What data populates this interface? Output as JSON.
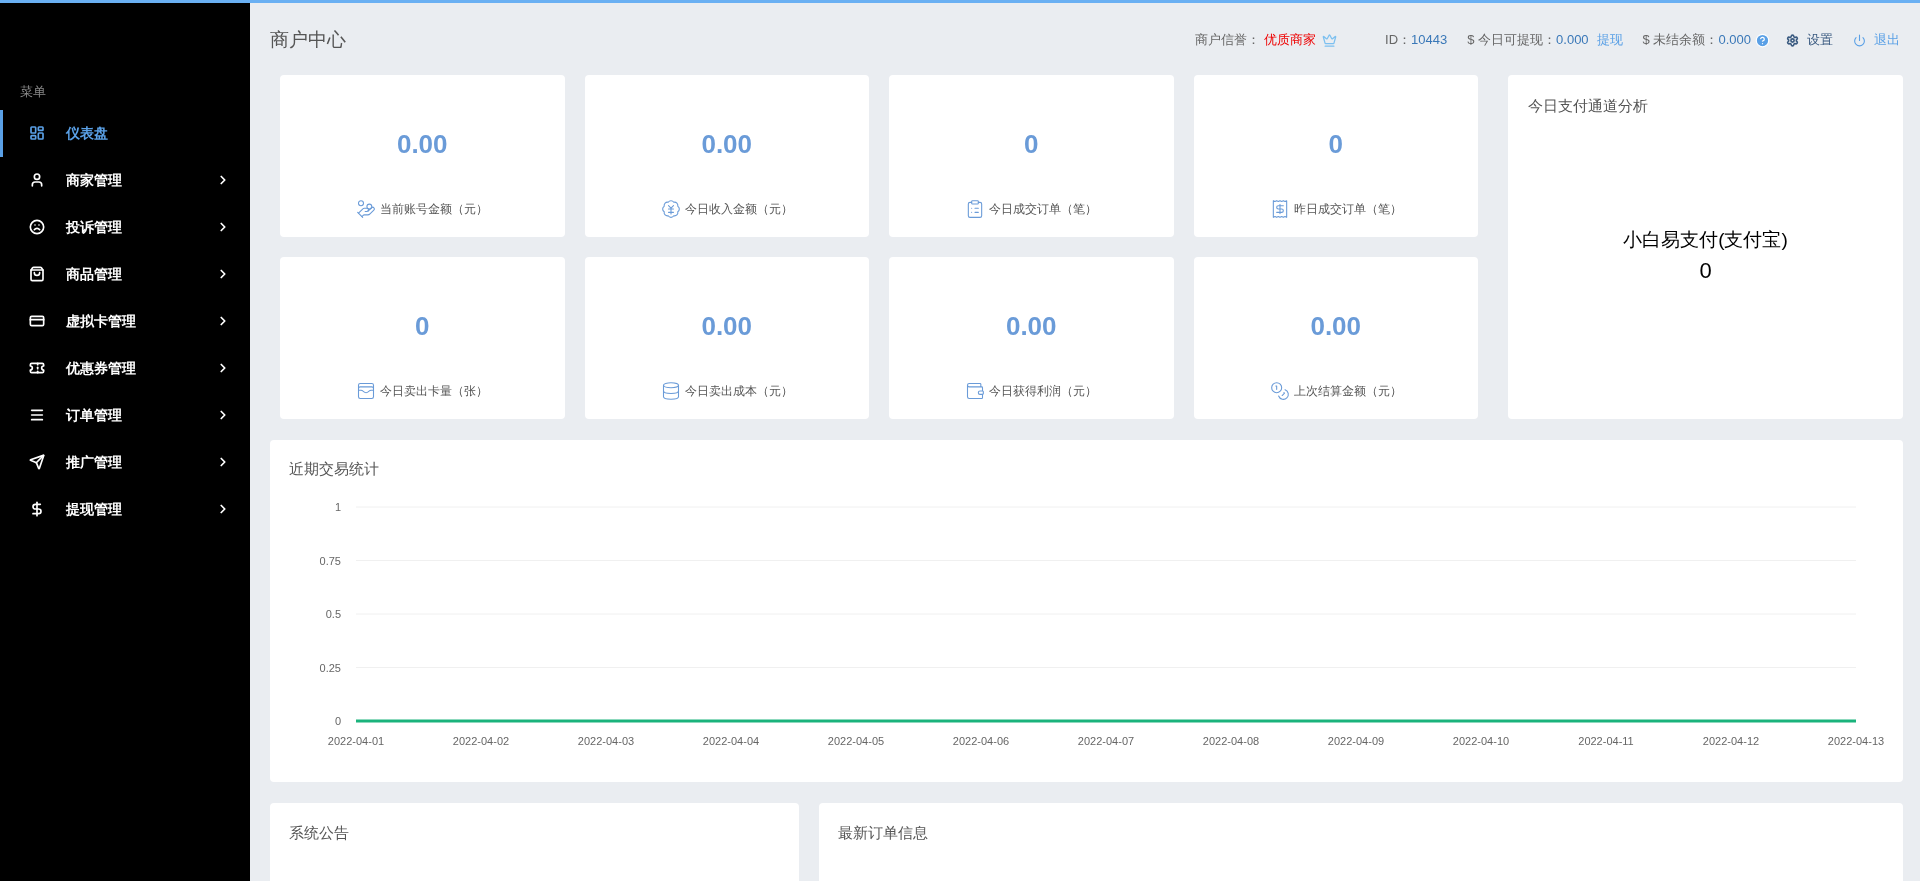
{
  "sidebar": {
    "heading": "菜单",
    "items": [
      {
        "label": "仪表盘",
        "selected": true,
        "expandable": false
      },
      {
        "label": "商家管理",
        "selected": false,
        "expandable": true
      },
      {
        "label": "投诉管理",
        "selected": false,
        "expandable": true
      },
      {
        "label": "商品管理",
        "selected": false,
        "expandable": true
      },
      {
        "label": "虚拟卡管理",
        "selected": false,
        "expandable": true
      },
      {
        "label": "优惠券管理",
        "selected": false,
        "expandable": true
      },
      {
        "label": "订单管理",
        "selected": false,
        "expandable": true
      },
      {
        "label": "推广管理",
        "selected": false,
        "expandable": true
      },
      {
        "label": "提现管理",
        "selected": false,
        "expandable": true
      }
    ]
  },
  "header": {
    "title": "商户中心",
    "credit_label": "商户信誉：",
    "credit_value": "优质商家",
    "id_label": "ID：",
    "id_value": "10443",
    "withdrawable_label": "$ 今日可提现：",
    "withdrawable_value": "0.000",
    "withdraw_link": "提现",
    "unsettled_label": "$ 未结余额：",
    "unsettled_value": "0.000",
    "settings": "设置",
    "logout": "退出"
  },
  "stats": [
    {
      "value": "0.00",
      "label": "当前账号金额（元）"
    },
    {
      "value": "0.00",
      "label": "今日收入金额（元）"
    },
    {
      "value": "0",
      "label": "今日成交订单（笔）"
    },
    {
      "value": "0",
      "label": "昨日成交订单（笔）"
    },
    {
      "value": "0",
      "label": "今日卖出卡量（张）"
    },
    {
      "value": "0.00",
      "label": "今日卖出成本（元）"
    },
    {
      "value": "0.00",
      "label": "今日获得利润（元）"
    },
    {
      "value": "0.00",
      "label": "上次结算金额（元）"
    }
  ],
  "channel_panel": {
    "title": "今日支付通道分析",
    "channel_name": "小白易支付(支付宝)",
    "channel_count": "0"
  },
  "trade_chart": {
    "title": "近期交易统计",
    "chart_data": {
      "type": "line",
      "grid": true,
      "categories": [
        "2022-04-01",
        "2022-04-02",
        "2022-04-03",
        "2022-04-04",
        "2022-04-05",
        "2022-04-06",
        "2022-04-07",
        "2022-04-08",
        "2022-04-09",
        "2022-04-10",
        "2022-04-11",
        "2022-04-12",
        "2022-04-13"
      ],
      "ylim": [
        0,
        1
      ],
      "yticks": [
        0,
        0.25,
        0.5,
        0.75,
        1
      ],
      "series": [
        {
          "color": "#1ab37c",
          "values": [
            0,
            0,
            0,
            0,
            0,
            0,
            0,
            0,
            0,
            0,
            0,
            0,
            0
          ]
        }
      ]
    }
  },
  "notice_panel": {
    "title": "系统公告"
  },
  "orders_panel": {
    "title": "最新订单信息"
  }
}
